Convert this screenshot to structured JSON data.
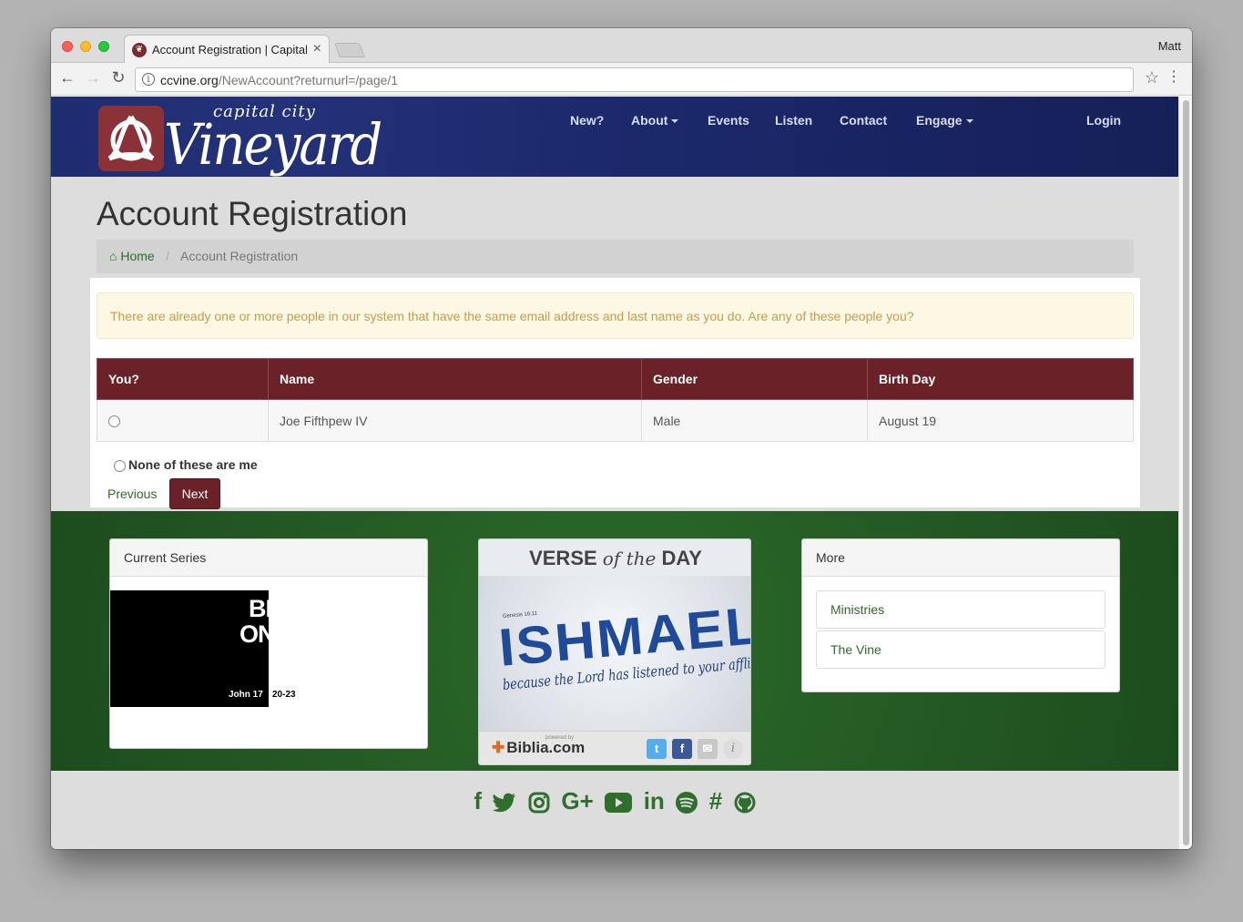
{
  "browser": {
    "tab_title": "Account Registration | Capital",
    "user": "Matt",
    "url_host": "ccvine.org",
    "url_path": "/NewAccount?returnurl=/page/1"
  },
  "site": {
    "logo_small": "capital city",
    "logo_big": "Vineyard",
    "nav": {
      "new": "New?",
      "about": "About",
      "events": "Events",
      "listen": "Listen",
      "contact": "Contact",
      "engage": "Engage",
      "login": "Login"
    }
  },
  "page": {
    "title": "Account Registration",
    "breadcrumb_home": "Home",
    "breadcrumb_current": "Account Registration",
    "alert": "There are already one or more people in our system that have the same email address and last name as you do. Are any of these people you?",
    "table": {
      "headers": [
        "You?",
        "Name",
        "Gender",
        "Birth Day"
      ],
      "rows": [
        {
          "name": "Joe Fifthpew IV",
          "gender": "Male",
          "birthday": "August 19"
        }
      ]
    },
    "none_label": "None of these are me",
    "previous_label": "Previous",
    "next_label": "Next"
  },
  "footer": {
    "series_title": "Current Series",
    "series_image": {
      "line1": "BE",
      "line2": "ONE",
      "left_ref": "John 17",
      "right_ref": "20-23"
    },
    "verse": {
      "title_a": "VERSE",
      "title_b": "of the",
      "title_c": "DAY",
      "reference": "Genesis 16:11",
      "word": "ISHMAEL",
      "subtitle": "because the Lord has listened to your affliction.",
      "powered_by": "powered by",
      "biblia": "Biblia.com"
    },
    "more_title": "More",
    "more_items": [
      "Ministries",
      "The Vine"
    ]
  },
  "social_icons": [
    "facebook-icon",
    "twitter-icon",
    "instagram-icon",
    "google-plus-icon",
    "youtube-icon",
    "linkedin-icon",
    "spotify-icon",
    "slack-icon",
    "github-icon"
  ],
  "colors": {
    "brand_maroon": "#6a2228",
    "header_blue": "#1b286a",
    "footer_green": "#235823",
    "link_green": "#2e6b2a",
    "alert_bg": "#fcf8e3"
  }
}
